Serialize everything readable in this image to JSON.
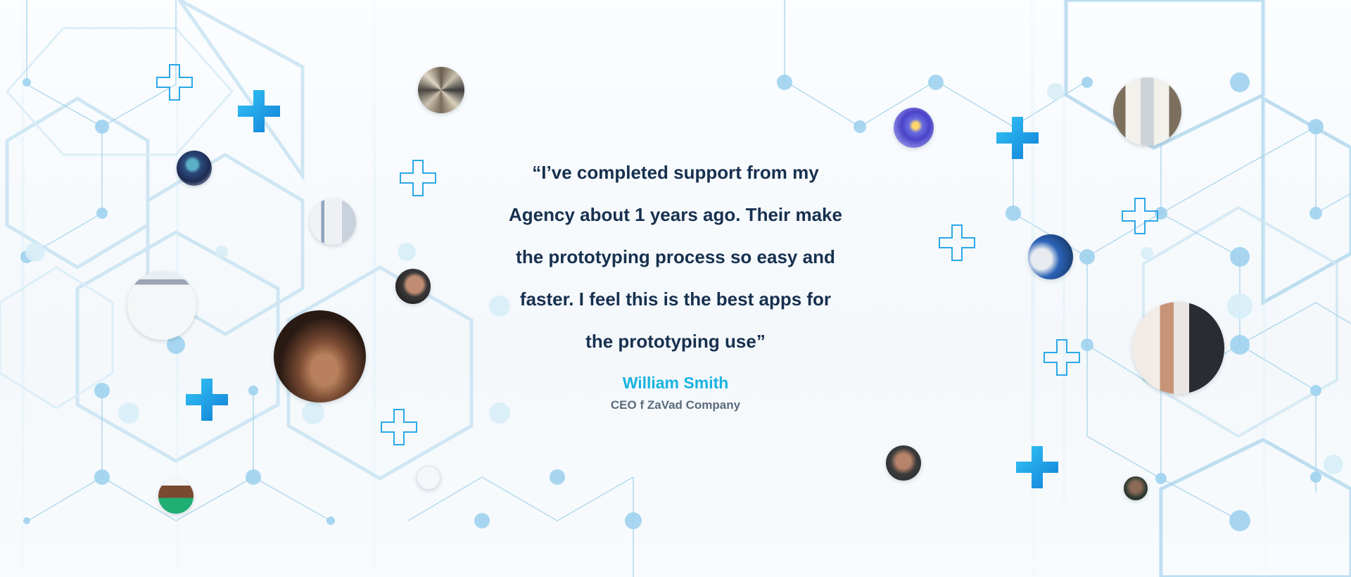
{
  "testimonial": {
    "quote": "“I’ve completed support from my\nAgency  about 1 years ago. Their make\nthe prototyping process so easy and\nfaster. I feel this is the best apps for\nthe prototyping use”",
    "author_name": "William Smith",
    "author_role": "CEO f ZaVad Company"
  },
  "colors": {
    "quote_text": "#17304f",
    "author_name": "#17b3e0",
    "author_role": "#5b6b7b",
    "accent_blue": "#1aa5e8",
    "hex_line": "#a9d3ea",
    "node": "#9fd2ee"
  },
  "icons": [
    "plus-solid-icon",
    "plus-outline-icon"
  ]
}
